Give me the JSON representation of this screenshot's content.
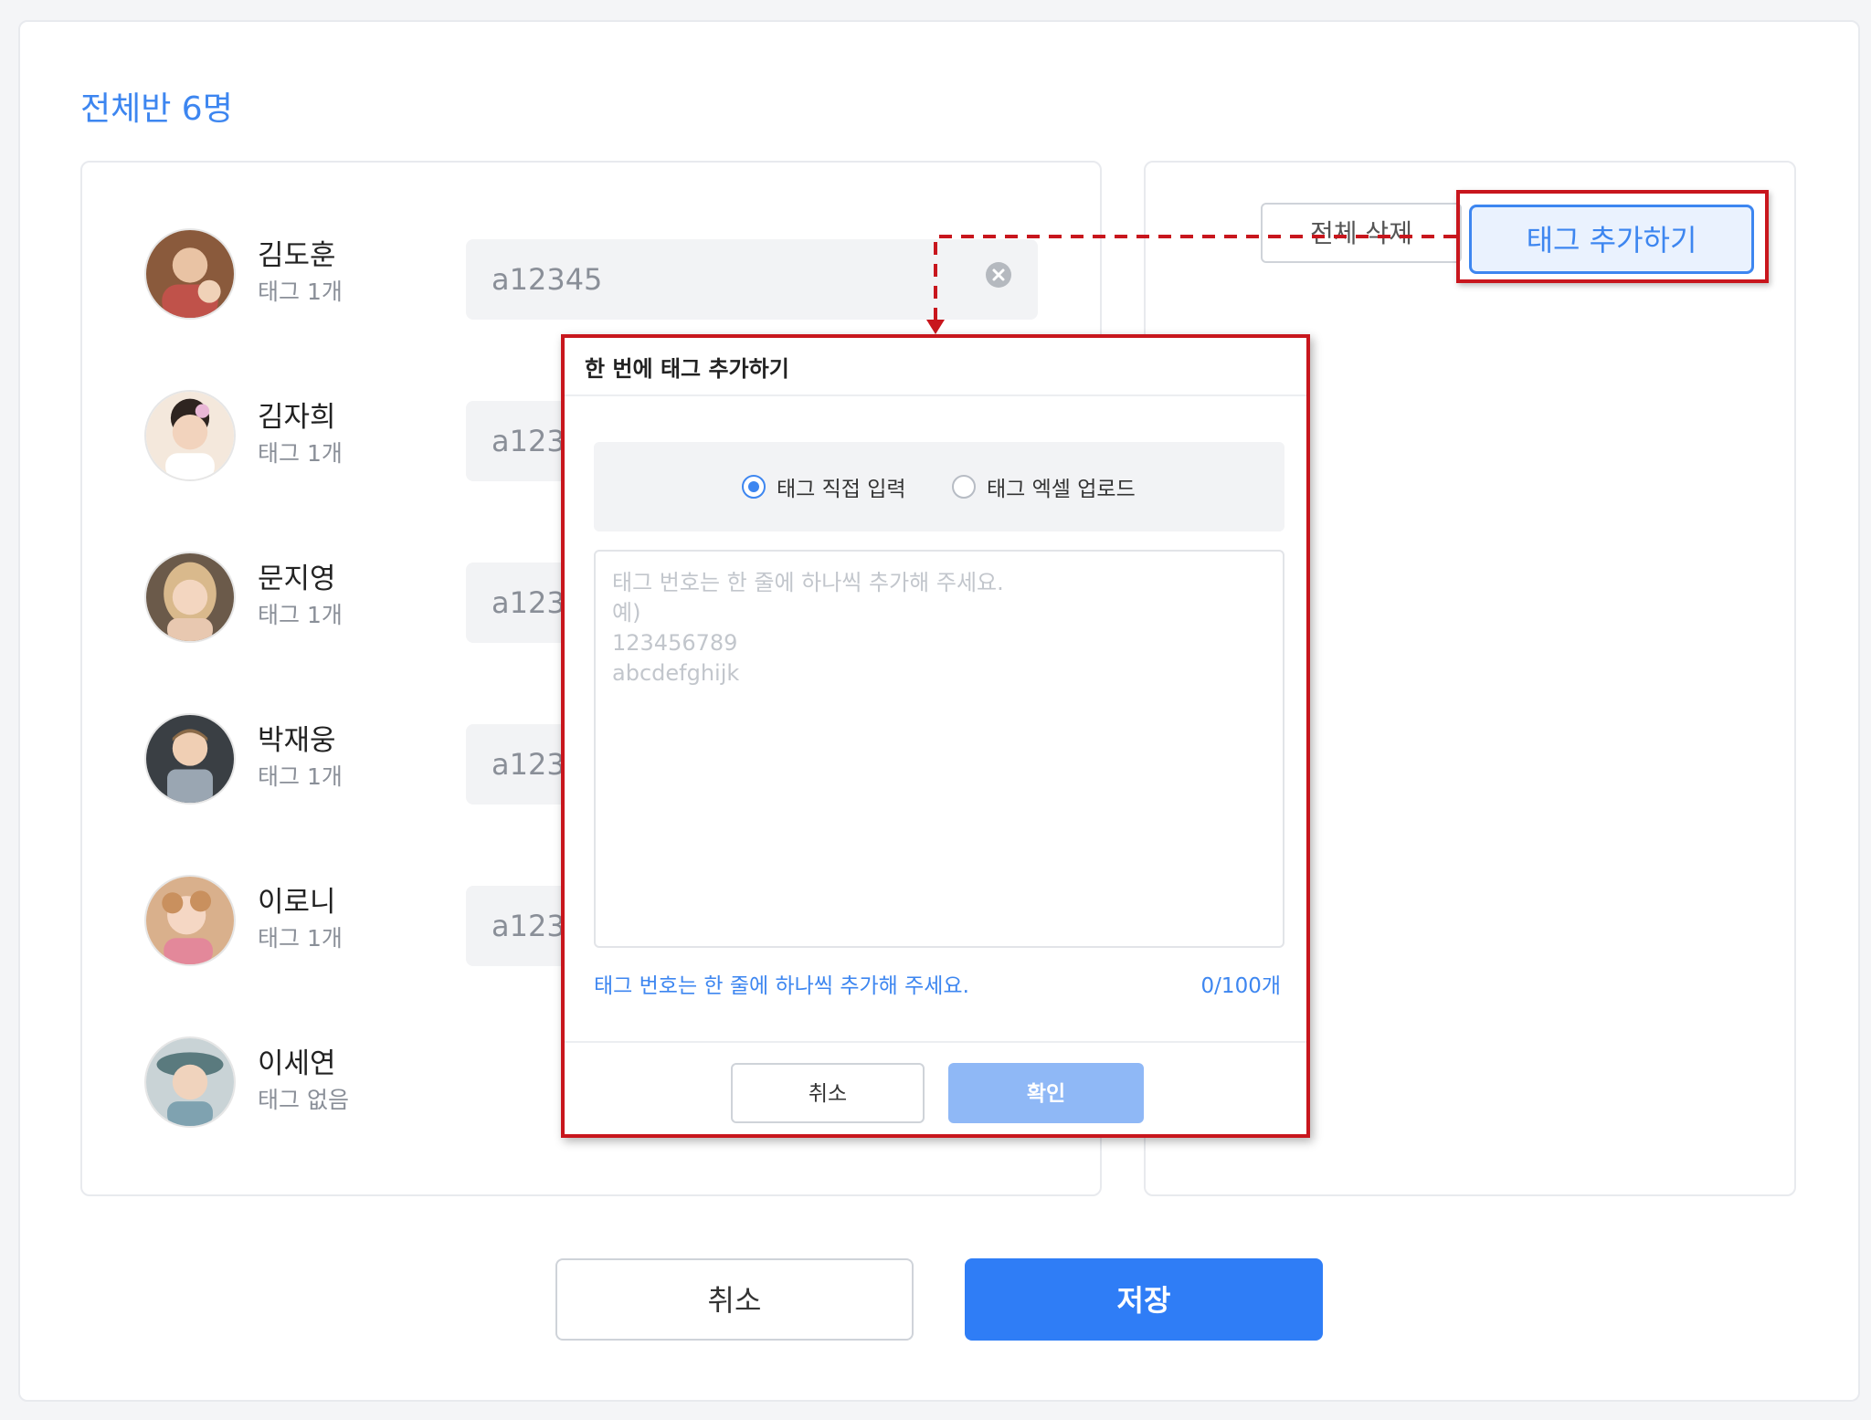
{
  "class_title": "전체반 6명",
  "students": [
    {
      "name": "김도훈",
      "tags": "태그 1개",
      "tag_value": "a12345"
    },
    {
      "name": "김자희",
      "tags": "태그 1개",
      "tag_value": "a12345"
    },
    {
      "name": "문지영",
      "tags": "태그 1개",
      "tag_value": "a12345"
    },
    {
      "name": "박재웅",
      "tags": "태그 1개",
      "tag_value": "a12345"
    },
    {
      "name": "이로니",
      "tags": "태그 1개",
      "tag_value": "a12345"
    },
    {
      "name": "이세연",
      "tags": "태그 없음",
      "tag_value": ""
    }
  ],
  "right_panel": {
    "delete_all_label": "전체 삭제",
    "add_tag_label": "태그 추가하기"
  },
  "modal": {
    "title": "한 번에 태그 추가하기",
    "radio_direct": "태그 직접 입력",
    "radio_excel": "태그 엑셀 업로드",
    "textarea_placeholder": "태그 번호는 한 줄에 하나씩 추가해 주세요.\n예)\n123456789\nabcdefghijk",
    "hint": "태그 번호는 한 줄에 하나씩 추가해 주세요.",
    "counter": "0/100개",
    "cancel_label": "취소",
    "confirm_label": "확인"
  },
  "footer": {
    "cancel_label": "취소",
    "save_label": "저장"
  },
  "colors": {
    "accent": "#3d86f0",
    "primary_button": "#2f7df6",
    "highlight": "#c8161d",
    "confirm_disabled": "#8fb8f6"
  }
}
